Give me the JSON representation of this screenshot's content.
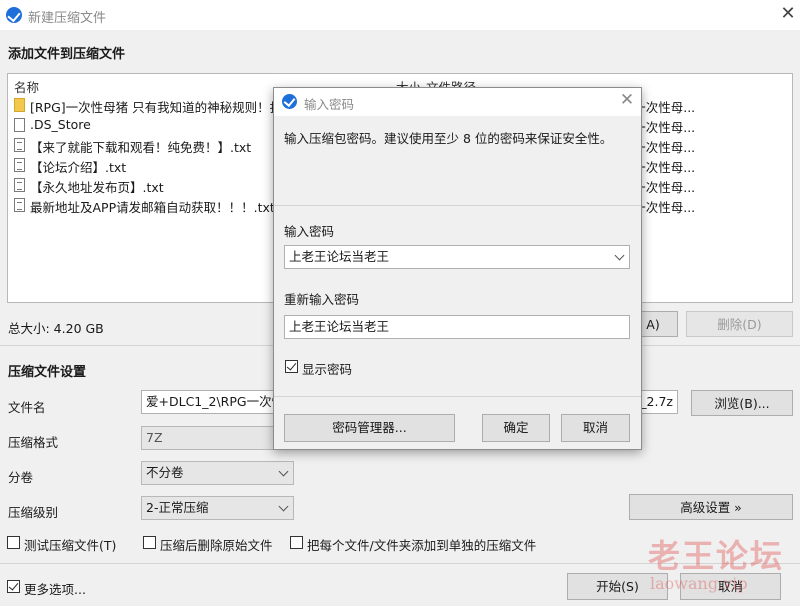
{
  "window": {
    "title": "新建压缩文件",
    "close_glyph": "✕"
  },
  "add_section": {
    "title": "添加文件到压缩文件"
  },
  "file_list": {
    "columns": {
      "name": "名称",
      "size": "大小",
      "path": "文件路径"
    },
    "rows": [
      {
        "icon": "folder-icon",
        "name": "[RPG]一次性母猪 只有我知道的神秘规则！打",
        "path": "PG一次性母..."
      },
      {
        "icon": "file-icon",
        "name": ".DS_Store",
        "path": "PG一次性母..."
      },
      {
        "icon": "text-file-icon",
        "name": "【来了就能下载和观看！纯免费！】.txt",
        "path": "PG一次性母..."
      },
      {
        "icon": "text-file-icon",
        "name": "【论坛介绍】.txt",
        "path": "PG一次性母..."
      },
      {
        "icon": "text-file-icon",
        "name": "【永久地址发布页】.txt",
        "path": "PG一次性母..."
      },
      {
        "icon": "text-file-icon",
        "name": "最新地址及APP请发邮箱自动获取！！！.txt",
        "path": "PG一次性母..."
      }
    ]
  },
  "total_size": "总大小: 4.20 GB",
  "buttons": {
    "add_partial": "A)",
    "delete": "删除(D)",
    "browse": "浏览(B)...",
    "advanced": "高级设置 »",
    "start": "开始(S)",
    "cancel": "取消"
  },
  "settings": {
    "title": "压缩文件设置",
    "filename_label": "文件名",
    "filename_value": "爱+DLC1_2\\RPG一次性",
    "filename_tail": "1_2.7z",
    "format_label": "压缩格式",
    "format_value": "7Z",
    "volume_label": "分卷",
    "volume_value": "不分卷",
    "level_label": "压缩级别",
    "level_value": "2-正常压缩"
  },
  "options": {
    "test": {
      "label": "测试压缩文件(T)",
      "checked": false
    },
    "delete_after": {
      "label": "压缩后删除原始文件",
      "checked": false
    },
    "separate": {
      "label": "把每个文件/文件夹添加到单独的压缩文件",
      "checked": false
    },
    "more": {
      "label": "更多选项...",
      "checked": true
    }
  },
  "dialog": {
    "title": "输入密码",
    "close_glyph": "✕",
    "description": "输入压缩包密码。建议使用至少 8 位的密码来保证安全性。",
    "password_label": "输入密码",
    "password_value": "上老王论坛当老王",
    "confirm_label": "重新输入密码",
    "confirm_value": "上老王论坛当老王",
    "show_password": {
      "label": "显示密码",
      "checked": true
    },
    "manager_button": "密码管理器...",
    "ok_button": "确定",
    "cancel_button": "取消"
  },
  "watermark": {
    "text": "老王论坛",
    "sub": "laowang.vip"
  }
}
